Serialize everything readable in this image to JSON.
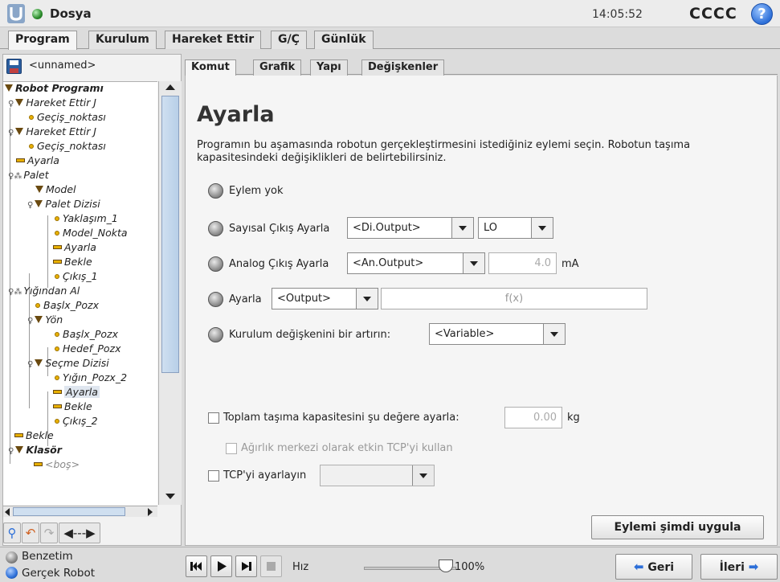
{
  "header": {
    "file_title": "Dosya",
    "time": "14:05:52",
    "robot_name": "CCCC",
    "help_icon": "?"
  },
  "main_tabs": [
    {
      "label": "Program",
      "active": true
    },
    {
      "label": "Kurulum",
      "active": false
    },
    {
      "label": "Hareket Ettir",
      "active": false
    },
    {
      "label": "G/Ç",
      "active": false
    },
    {
      "label": "Günlük",
      "active": false
    }
  ],
  "left_panel": {
    "program_name": "<unnamed>",
    "tree": [
      {
        "label": "Robot Programı",
        "icon": "triangle-icon"
      },
      {
        "label": "Hareket Ettir J",
        "icon": "triangle-icon"
      },
      {
        "label": "Geçiş_noktası",
        "icon": "waypoint-icon"
      },
      {
        "label": "Hareket Ettir J",
        "icon": "triangle-icon"
      },
      {
        "label": "Geçiş_noktası",
        "icon": "waypoint-icon"
      },
      {
        "label": "Ayarla",
        "icon": "set-icon"
      },
      {
        "label": "Palet",
        "icon": "pallet-icon"
      },
      {
        "label": "Model",
        "icon": "triangle-icon"
      },
      {
        "label": "Palet Dizisi",
        "icon": "triangle-icon"
      },
      {
        "label": "Yaklaşım_1",
        "icon": "waypoint-icon"
      },
      {
        "label": "Model_Nokta",
        "icon": "waypoint-icon"
      },
      {
        "label": "Ayarla",
        "icon": "set-icon"
      },
      {
        "label": "Bekle",
        "icon": "set-icon"
      },
      {
        "label": "Çıkış_1",
        "icon": "waypoint-icon"
      },
      {
        "label": "Yığından Al",
        "icon": "pallet-icon"
      },
      {
        "label": "Başlx_Pozx",
        "icon": "waypoint-icon"
      },
      {
        "label": "Yön",
        "icon": "triangle-icon"
      },
      {
        "label": "Başlx_Pozx",
        "icon": "waypoint-icon"
      },
      {
        "label": "Hedef_Pozx",
        "icon": "waypoint-icon"
      },
      {
        "label": "Seçme Dizisi",
        "icon": "triangle-icon"
      },
      {
        "label": "Yığın_Pozx_2",
        "icon": "waypoint-icon"
      },
      {
        "label": "Ayarla",
        "icon": "set-icon"
      },
      {
        "label": "Bekle",
        "icon": "set-icon"
      },
      {
        "label": "Çıkış_2",
        "icon": "waypoint-icon"
      },
      {
        "label": "Bekle",
        "icon": "set-icon"
      },
      {
        "label": "Klasör",
        "icon": "triangle-icon"
      },
      {
        "label": "<boş>",
        "icon": "set-icon"
      }
    ]
  },
  "sub_tabs": [
    {
      "label": "Komut",
      "active": true
    },
    {
      "label": "Grafik",
      "active": false
    },
    {
      "label": "Yapı",
      "active": false
    },
    {
      "label": "Değişkenler",
      "active": false
    }
  ],
  "command": {
    "heading": "Ayarla",
    "description": "Programın bu aşamasında robotun gerçekleştirmesini istediğiniz eylemi seçin. Robotun taşıma kapasitesindeki değişiklikleri de belirtebilirsiniz.",
    "opt_none": "Eylem yok",
    "opt_digital": "Sayısal Çıkış Ayarla",
    "digital_output": "<Di.Output>",
    "digital_value": "LO",
    "opt_analog": "Analog Çıkış Ayarla",
    "analog_output": "<An.Output>",
    "analog_value": "4.0",
    "analog_unit": "mA",
    "opt_set": "Ayarla",
    "set_output": "<Output>",
    "set_expr": "f(x)",
    "opt_increment": "Kurulum değişkenini bir artırın:",
    "increment_var": "<Variable>",
    "payload_label": "Toplam taşıma kapasitesini şu değere ayarla:",
    "payload_value": "0.00",
    "payload_unit": "kg",
    "cog_label": "Ağırlık merkezi olarak etkin TCP'yi kullan",
    "tcp_label": "TCP'yi ayarlayın",
    "tcp_value": "",
    "apply_button": "Eylemi şimdi uygula"
  },
  "bottom": {
    "mode_sim": "Benzetim",
    "mode_real": "Gerçek Robot",
    "speed_label": "Hız",
    "speed_value": "100%",
    "speed_fraction": 1.0,
    "back_button": "Geri",
    "next_button": "İleri"
  },
  "colors": {
    "accent": "#2d6fd8",
    "waypoint": "#e8b000",
    "status_ok": "#2a8a2a"
  }
}
